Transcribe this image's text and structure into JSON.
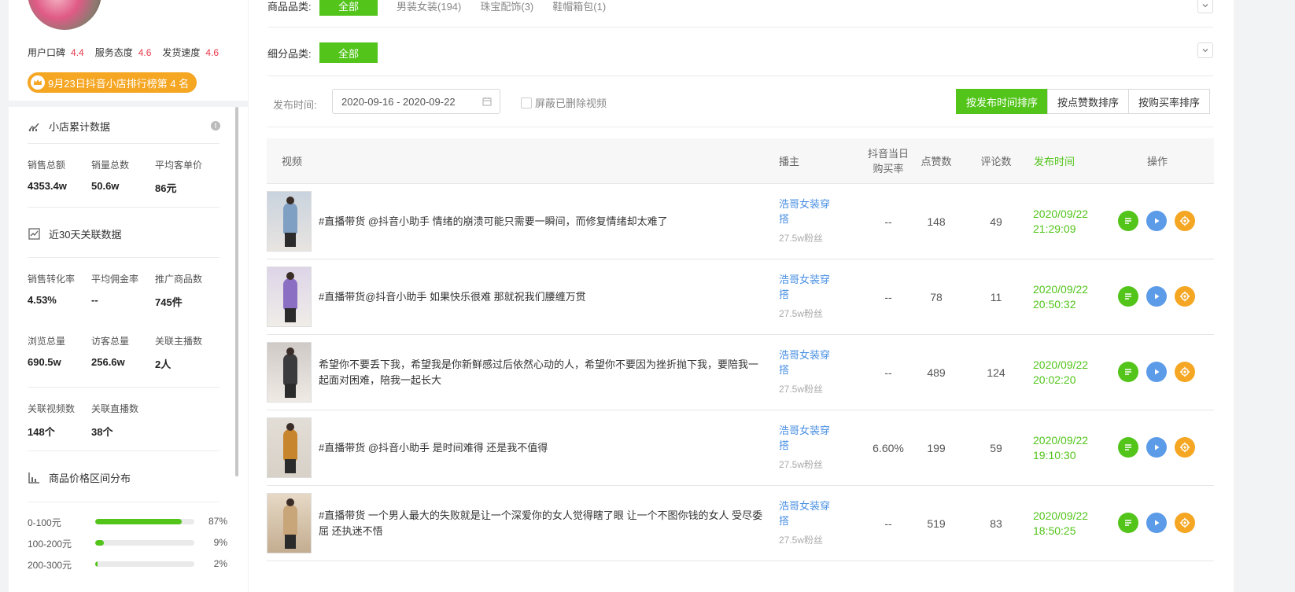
{
  "sidebar": {
    "ratings": [
      {
        "label": "用户口碑",
        "value": "4.4"
      },
      {
        "label": "服务态度",
        "value": "4.6"
      },
      {
        "label": "发货速度",
        "value": "4.6"
      }
    ],
    "rank_badge": "9月23日抖音小店排行榜第 4 名",
    "store_stats_title": "小店累计数据",
    "store_stats": [
      {
        "label": "销售总额",
        "value": "4353.4w"
      },
      {
        "label": "销量总数",
        "value": "50.6w"
      },
      {
        "label": "平均客单价",
        "value": "86元"
      }
    ],
    "related_title": "近30天关联数据",
    "related_stats_row1": [
      {
        "label": "销售转化率",
        "value": "4.53%"
      },
      {
        "label": "平均佣金率",
        "value": "--"
      },
      {
        "label": "推广商品数",
        "value": "745件"
      }
    ],
    "related_stats_row2": [
      {
        "label": "浏览总量",
        "value": "690.5w"
      },
      {
        "label": "访客总量",
        "value": "256.6w"
      },
      {
        "label": "关联主播数",
        "value": "2人"
      }
    ],
    "related_stats_row3": [
      {
        "label": "关联视频数",
        "value": "148个"
      },
      {
        "label": "关联直播数",
        "value": "38个"
      }
    ],
    "price_title": "商品价格区间分布",
    "price_dist": [
      {
        "label": "0-100元",
        "pct": "87%",
        "fraction": 0.87
      },
      {
        "label": "100-200元",
        "pct": "9%",
        "fraction": 0.09
      },
      {
        "label": "200-300元",
        "pct": "2%",
        "fraction": 0.02
      }
    ]
  },
  "filters": {
    "category_label": "商品品类:",
    "category_all": "全部",
    "categories": [
      "男装女装(194)",
      "珠宝配饰(3)",
      "鞋帽箱包(1)"
    ],
    "subcategory_label": "细分品类:",
    "subcategory_all": "全部",
    "date_label": "发布时间:",
    "date_range": "2020-09-16 - 2020-09-22",
    "hide_deleted": "屏蔽已删除视频",
    "sort_buttons": [
      "按发布时间排序",
      "按点赞数排序",
      "按购买率排序"
    ]
  },
  "table": {
    "headers": {
      "video": "视频",
      "anchor": "播主",
      "buy_rate_1": "抖音当日",
      "buy_rate_2": "购买率",
      "likes": "点赞数",
      "comments": "评论数",
      "time": "发布时间",
      "ops": "操作"
    },
    "rows": [
      {
        "title": "#直播带货 @抖音小助手 情绪的崩溃可能只需要一瞬间，而修复情绪却太难了",
        "anchor_1": "浩哥女装穿",
        "anchor_2": "搭",
        "fans": "27.5w粉丝",
        "buy_rate": "--",
        "likes": "148",
        "comments": "49",
        "date": "2020/09/22",
        "time": "21:29:09"
      },
      {
        "title": "#直播带货@抖音小助手 如果快乐很难 那就祝我们腰缠万贯",
        "anchor_1": "浩哥女装穿",
        "anchor_2": "搭",
        "fans": "27.5w粉丝",
        "buy_rate": "--",
        "likes": "78",
        "comments": "11",
        "date": "2020/09/22",
        "time": "20:50:32"
      },
      {
        "title": "希望你不要丢下我，希望我是你新鲜感过后依然心动的人，希望你不要因为挫折抛下我，要陪我一起面对困难，陪我一起长大",
        "anchor_1": "浩哥女装穿",
        "anchor_2": "搭",
        "fans": "27.5w粉丝",
        "buy_rate": "--",
        "likes": "489",
        "comments": "124",
        "date": "2020/09/22",
        "time": "20:02:20"
      },
      {
        "title": "#直播带货 @抖音小助手 是时间难得 还是我不值得",
        "anchor_1": "浩哥女装穿",
        "anchor_2": "搭",
        "fans": "27.5w粉丝",
        "buy_rate": "6.60%",
        "likes": "199",
        "comments": "59",
        "date": "2020/09/22",
        "time": "19:10:30"
      },
      {
        "title": "#直播带货 一个男人最大的失败就是让一个深爱你的女人觉得瞎了眼 让一个不图你钱的女人 受尽委屈 还执迷不悟",
        "anchor_1": "浩哥女装穿",
        "anchor_2": "搭",
        "fans": "27.5w粉丝",
        "buy_rate": "--",
        "likes": "519",
        "comments": "83",
        "date": "2020/09/22",
        "time": "18:50:25"
      }
    ]
  },
  "colors": {
    "accent": "#52c41a",
    "link": "#4a90e2",
    "badge": "#f5a623",
    "rating": "#e8374a"
  }
}
